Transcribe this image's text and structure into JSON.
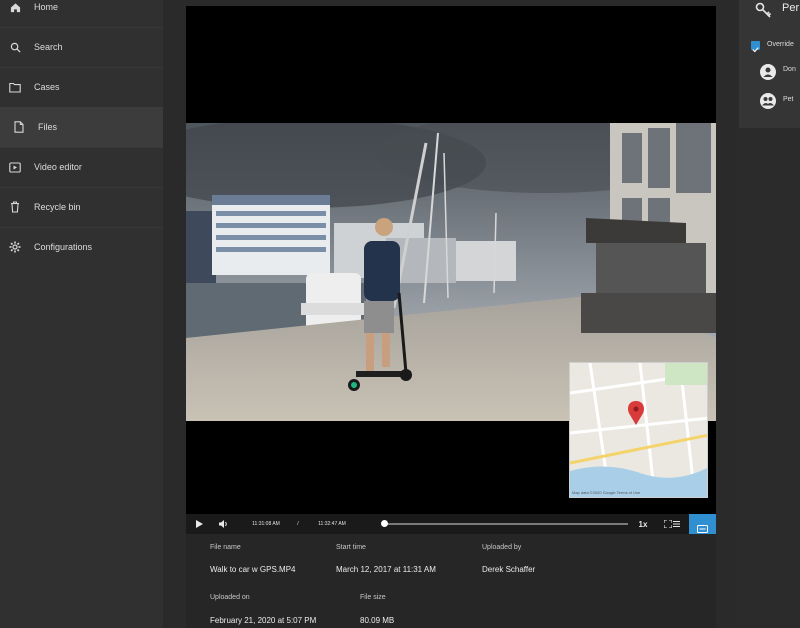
{
  "sidebar": {
    "items": [
      {
        "label": "Home",
        "icon": "home-icon"
      },
      {
        "label": "Search",
        "icon": "search-icon"
      },
      {
        "label": "Cases",
        "icon": "folder-icon"
      },
      {
        "label": "Files",
        "icon": "file-icon",
        "active": true
      },
      {
        "label": "Video editor",
        "icon": "video-editor-icon"
      },
      {
        "label": "Recycle bin",
        "icon": "trash-icon"
      },
      {
        "label": "Configurations",
        "icon": "gear-icon"
      }
    ]
  },
  "player": {
    "current_time": "11:31:08 AM",
    "separator": "/",
    "end_time": "11:32:47 AM",
    "progress": 0.0,
    "speed": "1x",
    "map_attribution": "Map data ©2020 Google   Terms of Use"
  },
  "metadata": {
    "file_name_label": "File name",
    "file_name": "Walk to car w GPS.MP4",
    "start_time_label": "Start time",
    "start_time": "March 12, 2017 at 11:31 AM",
    "uploaded_by_label": "Uploaded by",
    "uploaded_by": "Derek Schaffer",
    "uploaded_on_label": "Uploaded on",
    "uploaded_on": "February 21, 2020 at 5:07 PM",
    "file_size_label": "File size",
    "file_size": "80.09 MB"
  },
  "permissions": {
    "title": "Per",
    "override_label": "Override",
    "override_checked": true,
    "users": [
      {
        "name": "Don",
        "icon": "user-icon"
      },
      {
        "name": "Pet",
        "icon": "group-icon"
      }
    ]
  },
  "colors": {
    "accent": "#2f8fd0",
    "map_pin": "#d93a3a"
  }
}
